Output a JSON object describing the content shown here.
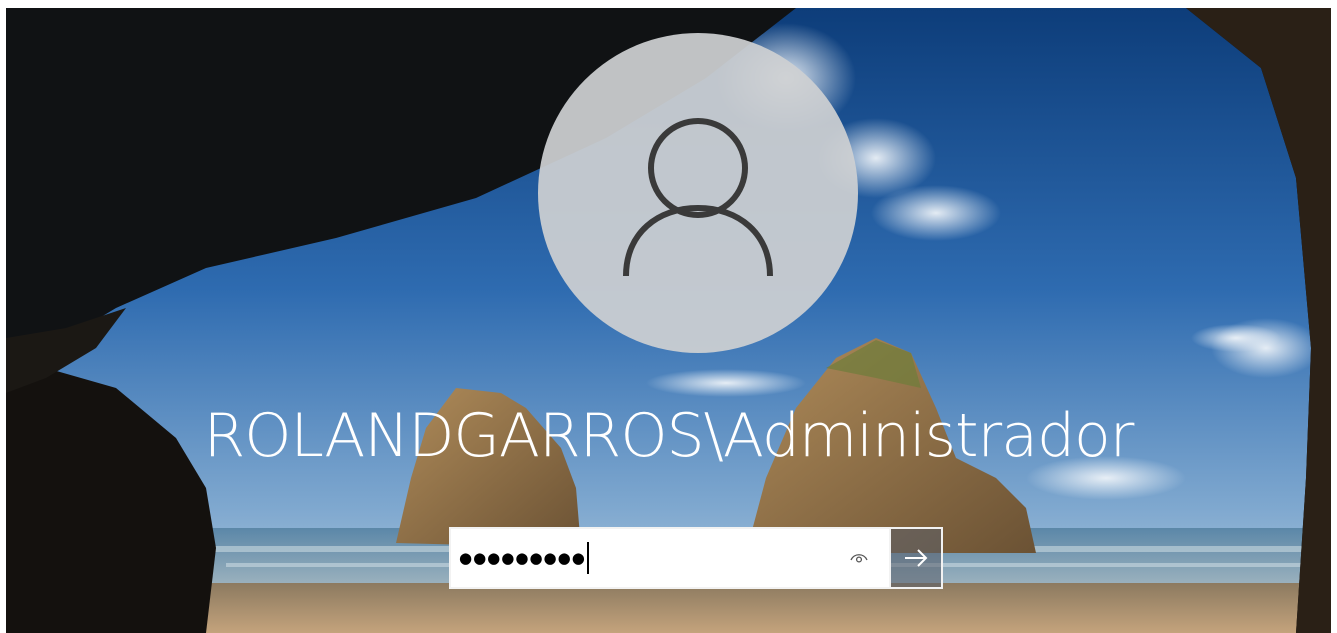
{
  "login": {
    "username": "ROLANDGARROS\\Administrador",
    "password_masked": "●●●●●●●●●",
    "password_length": 9
  },
  "icons": {
    "avatar": "user-silhouette-icon",
    "reveal": "eye-icon",
    "submit": "arrow-right-icon"
  },
  "colors": {
    "avatar_bg": "#cdd0d2",
    "avatar_glyph": "#3a3a3a",
    "text": "#ffffff",
    "field_bg": "#ffffff",
    "submit_bg": "#5a5f69"
  }
}
